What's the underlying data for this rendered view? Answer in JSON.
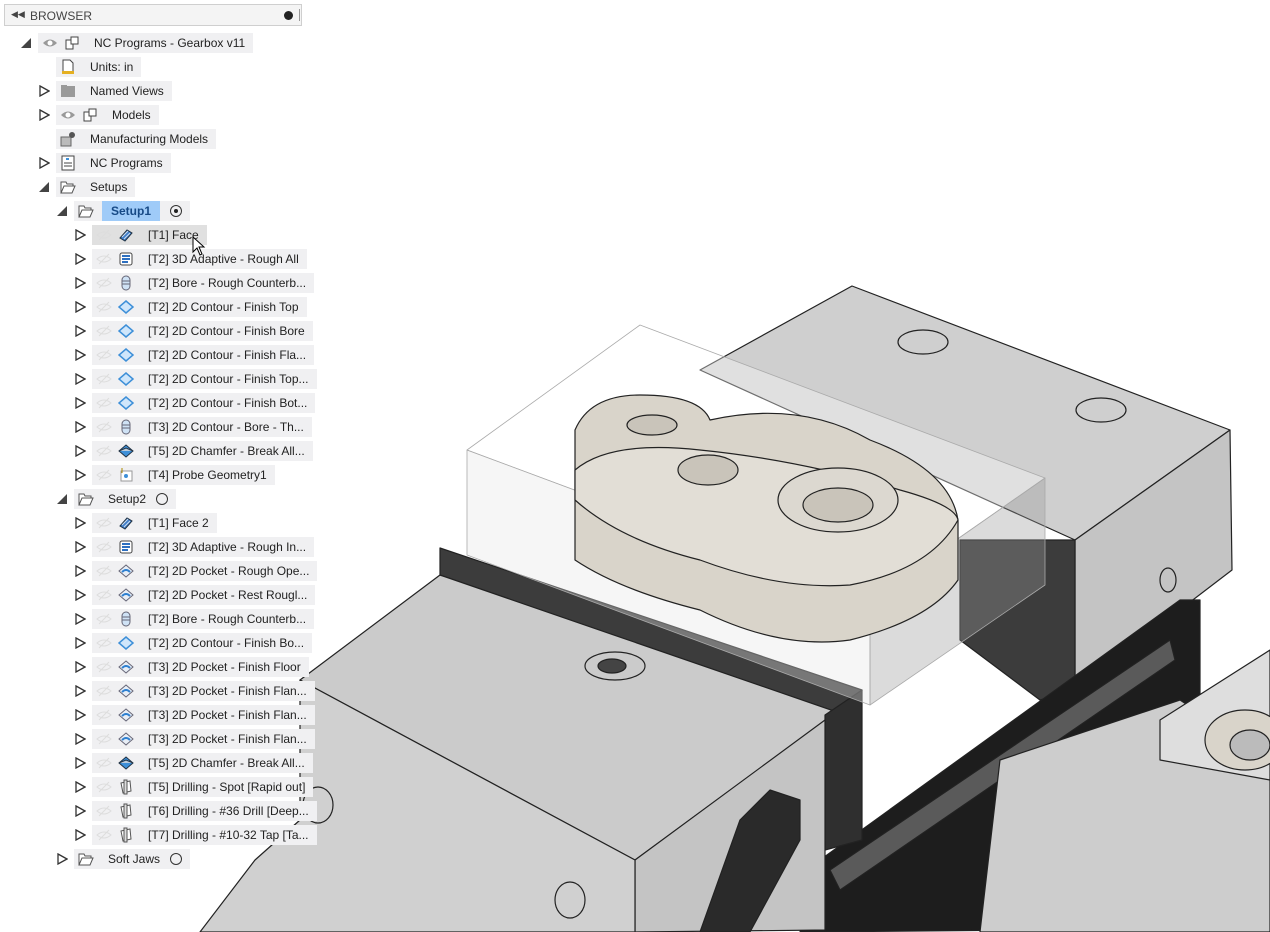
{
  "browser": {
    "title": "BROWSER"
  },
  "tree": [
    {
      "level": 0,
      "expander": "open",
      "eye": "visible",
      "icon": "component",
      "label": "NC Programs - Gearbox v11"
    },
    {
      "level": 1,
      "expander": "none",
      "icon": "units",
      "label": "Units: in"
    },
    {
      "level": 1,
      "expander": "closed",
      "icon": "folder",
      "label": "Named Views"
    },
    {
      "level": 1,
      "expander": "closed",
      "eye": "visible",
      "icon": "component",
      "label": "Models"
    },
    {
      "level": 1,
      "expander": "none",
      "icon": "mfg-model",
      "label": "Manufacturing Models"
    },
    {
      "level": 1,
      "expander": "closed",
      "icon": "nc-program",
      "label": "NC Programs"
    },
    {
      "level": 1,
      "expander": "open",
      "icon": "open-folder",
      "label": "Setups"
    },
    {
      "level": 2,
      "expander": "open",
      "icon": "open-folder",
      "label": "Setup1",
      "highlight": true,
      "radio": "on"
    },
    {
      "level": 3,
      "expander": "closed",
      "eye": "hidden",
      "icon": "face",
      "label": "[T1] Face",
      "hover": true
    },
    {
      "level": 3,
      "expander": "closed",
      "eye": "hidden",
      "icon": "adaptive",
      "label": "[T2] 3D Adaptive - Rough All"
    },
    {
      "level": 3,
      "expander": "closed",
      "eye": "hidden",
      "icon": "bore",
      "label": "[T2] Bore - Rough Counterb..."
    },
    {
      "level": 3,
      "expander": "closed",
      "eye": "hidden",
      "icon": "contour",
      "label": "[T2] 2D Contour - Finish Top"
    },
    {
      "level": 3,
      "expander": "closed",
      "eye": "hidden",
      "icon": "contour",
      "label": "[T2] 2D Contour - Finish Bore"
    },
    {
      "level": 3,
      "expander": "closed",
      "eye": "hidden",
      "icon": "contour",
      "label": "[T2] 2D Contour - Finish Fla..."
    },
    {
      "level": 3,
      "expander": "closed",
      "eye": "hidden",
      "icon": "contour",
      "label": "[T2] 2D Contour - Finish Top..."
    },
    {
      "level": 3,
      "expander": "closed",
      "eye": "hidden",
      "icon": "contour",
      "label": "[T2] 2D Contour - Finish Bot..."
    },
    {
      "level": 3,
      "expander": "closed",
      "eye": "hidden",
      "icon": "bore",
      "label": "[T3] 2D Contour - Bore - Th..."
    },
    {
      "level": 3,
      "expander": "closed",
      "eye": "hidden",
      "icon": "chamfer",
      "label": "[T5] 2D Chamfer - Break All..."
    },
    {
      "level": 3,
      "expander": "closed",
      "eye": "hidden",
      "icon": "probe",
      "label": "[T4] Probe Geometry1"
    },
    {
      "level": 2,
      "expander": "open",
      "icon": "open-folder",
      "label": "Setup2",
      "radio": "off"
    },
    {
      "level": 3,
      "expander": "closed",
      "eye": "hidden",
      "icon": "face",
      "label": "[T1] Face 2"
    },
    {
      "level": 3,
      "expander": "closed",
      "eye": "hidden",
      "icon": "adaptive",
      "label": "[T2] 3D Adaptive - Rough In..."
    },
    {
      "level": 3,
      "expander": "closed",
      "eye": "hidden",
      "icon": "pocket",
      "label": "[T2] 2D Pocket - Rough Ope..."
    },
    {
      "level": 3,
      "expander": "closed",
      "eye": "hidden",
      "icon": "pocket",
      "label": "[T2] 2D Pocket - Rest Rougl..."
    },
    {
      "level": 3,
      "expander": "closed",
      "eye": "hidden",
      "icon": "bore",
      "label": "[T2] Bore - Rough Counterb..."
    },
    {
      "level": 3,
      "expander": "closed",
      "eye": "hidden",
      "icon": "contour",
      "label": "[T2] 2D Contour - Finish Bo..."
    },
    {
      "level": 3,
      "expander": "closed",
      "eye": "hidden",
      "icon": "pocket",
      "label": "[T3] 2D Pocket - Finish Floor"
    },
    {
      "level": 3,
      "expander": "closed",
      "eye": "hidden",
      "icon": "pocket",
      "label": "[T3] 2D Pocket - Finish Flan..."
    },
    {
      "level": 3,
      "expander": "closed",
      "eye": "hidden",
      "icon": "pocket",
      "label": "[T3] 2D Pocket - Finish Flan..."
    },
    {
      "level": 3,
      "expander": "closed",
      "eye": "hidden",
      "icon": "pocket",
      "label": "[T3] 2D Pocket - Finish Flan..."
    },
    {
      "level": 3,
      "expander": "closed",
      "eye": "hidden",
      "icon": "chamfer",
      "label": "[T5] 2D Chamfer - Break All..."
    },
    {
      "level": 3,
      "expander": "closed",
      "eye": "hidden",
      "icon": "drilling",
      "label": "[T5] Drilling - Spot [Rapid out]"
    },
    {
      "level": 3,
      "expander": "closed",
      "eye": "hidden",
      "icon": "drilling",
      "label": "[T6] Drilling - #36 Drill [Deep..."
    },
    {
      "level": 3,
      "expander": "closed",
      "eye": "hidden",
      "icon": "drilling",
      "label": "[T7] Drilling - #10-32 Tap [Ta..."
    },
    {
      "level": 2,
      "expander": "closed",
      "icon": "open-folder",
      "label": "Soft Jaws",
      "radio": "off"
    }
  ],
  "colors": {
    "highlight": "#9fcbf8",
    "op_blue": "#3d8fd8",
    "part": "#d9d4ca",
    "vise": "#d2d2d2"
  }
}
